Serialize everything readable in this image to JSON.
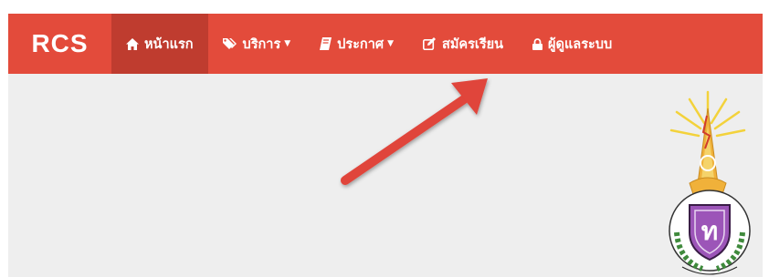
{
  "navbar": {
    "brand": "RCS",
    "items": [
      {
        "label": "หน้าแรก",
        "icon": "home-icon",
        "active": true
      },
      {
        "label": "บริการ",
        "icon": "tags-icon",
        "dropdown": true
      },
      {
        "label": "ประกาศ",
        "icon": "book-icon",
        "dropdown": true
      },
      {
        "label": "สมัครเรียน",
        "icon": "edit-icon"
      },
      {
        "label": "ผู้ดูแลระบบ",
        "icon": "lock-icon"
      }
    ]
  },
  "colors": {
    "navbar": "#e34b3b",
    "active": "#bf3c2f",
    "content": "#eeeeee",
    "arrow": "#e0443a"
  },
  "annotation": {
    "icon": "arrow-icon"
  },
  "logo": {
    "icon": "school-emblem-icon"
  }
}
